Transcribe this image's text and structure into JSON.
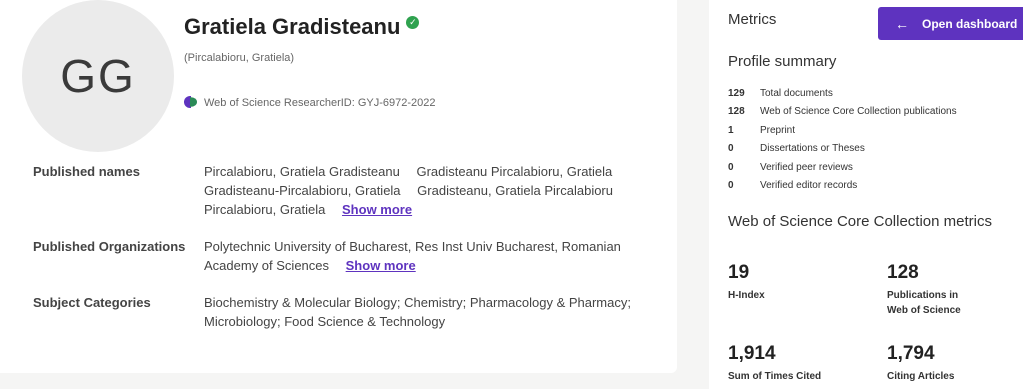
{
  "profile": {
    "initials": "GG",
    "name": "Gratiela Gradisteanu",
    "alt_name": "(Pircalabioru, Gratiela)",
    "researcher_id": "Web of Science ResearcherID: GYJ-6972-2022"
  },
  "info": {
    "published_names_label": "Published names",
    "published_names": [
      "Pircalabioru, Gratiela Gradisteanu",
      "Gradisteanu Pircalabioru, Gratiela",
      "Gradisteanu-Pircalabioru, Gratiela",
      "Gradisteanu, Gratiela Pircalabioru",
      "Pircalabioru, Gratiela"
    ],
    "show_more": "Show more",
    "organizations_label": "Published Organizations",
    "organizations_line1": "Polytechnic University of Bucharest, Res Inst Univ Bucharest, Romanian",
    "organizations_line2": "Academy of Sciences",
    "subjects_label": "Subject Categories",
    "subjects_line1": "Biochemistry & Molecular Biology; Chemistry; Pharmacology & Pharmacy;",
    "subjects_line2": "Microbiology; Food Science & Technology"
  },
  "metrics": {
    "title": "Metrics",
    "open_dashboard": "Open dashboard",
    "profile_summary_title": "Profile summary",
    "summary": [
      {
        "count": "129",
        "label": "Total documents"
      },
      {
        "count": "128",
        "label": "Web of Science Core Collection publications"
      },
      {
        "count": "1",
        "label": "Preprint"
      },
      {
        "count": "0",
        "label": "Dissertations or Theses"
      },
      {
        "count": "0",
        "label": "Verified peer reviews"
      },
      {
        "count": "0",
        "label": "Verified editor records"
      }
    ],
    "core_title": "Web of Science Core Collection metrics",
    "h_index_value": "19",
    "h_index_label": "H-Index",
    "publications_value": "128",
    "publications_label_1": "Publications in",
    "publications_label_2": "Web of Science",
    "times_cited_value": "1,914",
    "times_cited_label": "Sum of Times Cited",
    "citing_articles_value": "1,794",
    "citing_articles_label": "Citing Articles"
  },
  "colors": {
    "accent": "#5e33bf",
    "verified": "#2fa24f"
  }
}
